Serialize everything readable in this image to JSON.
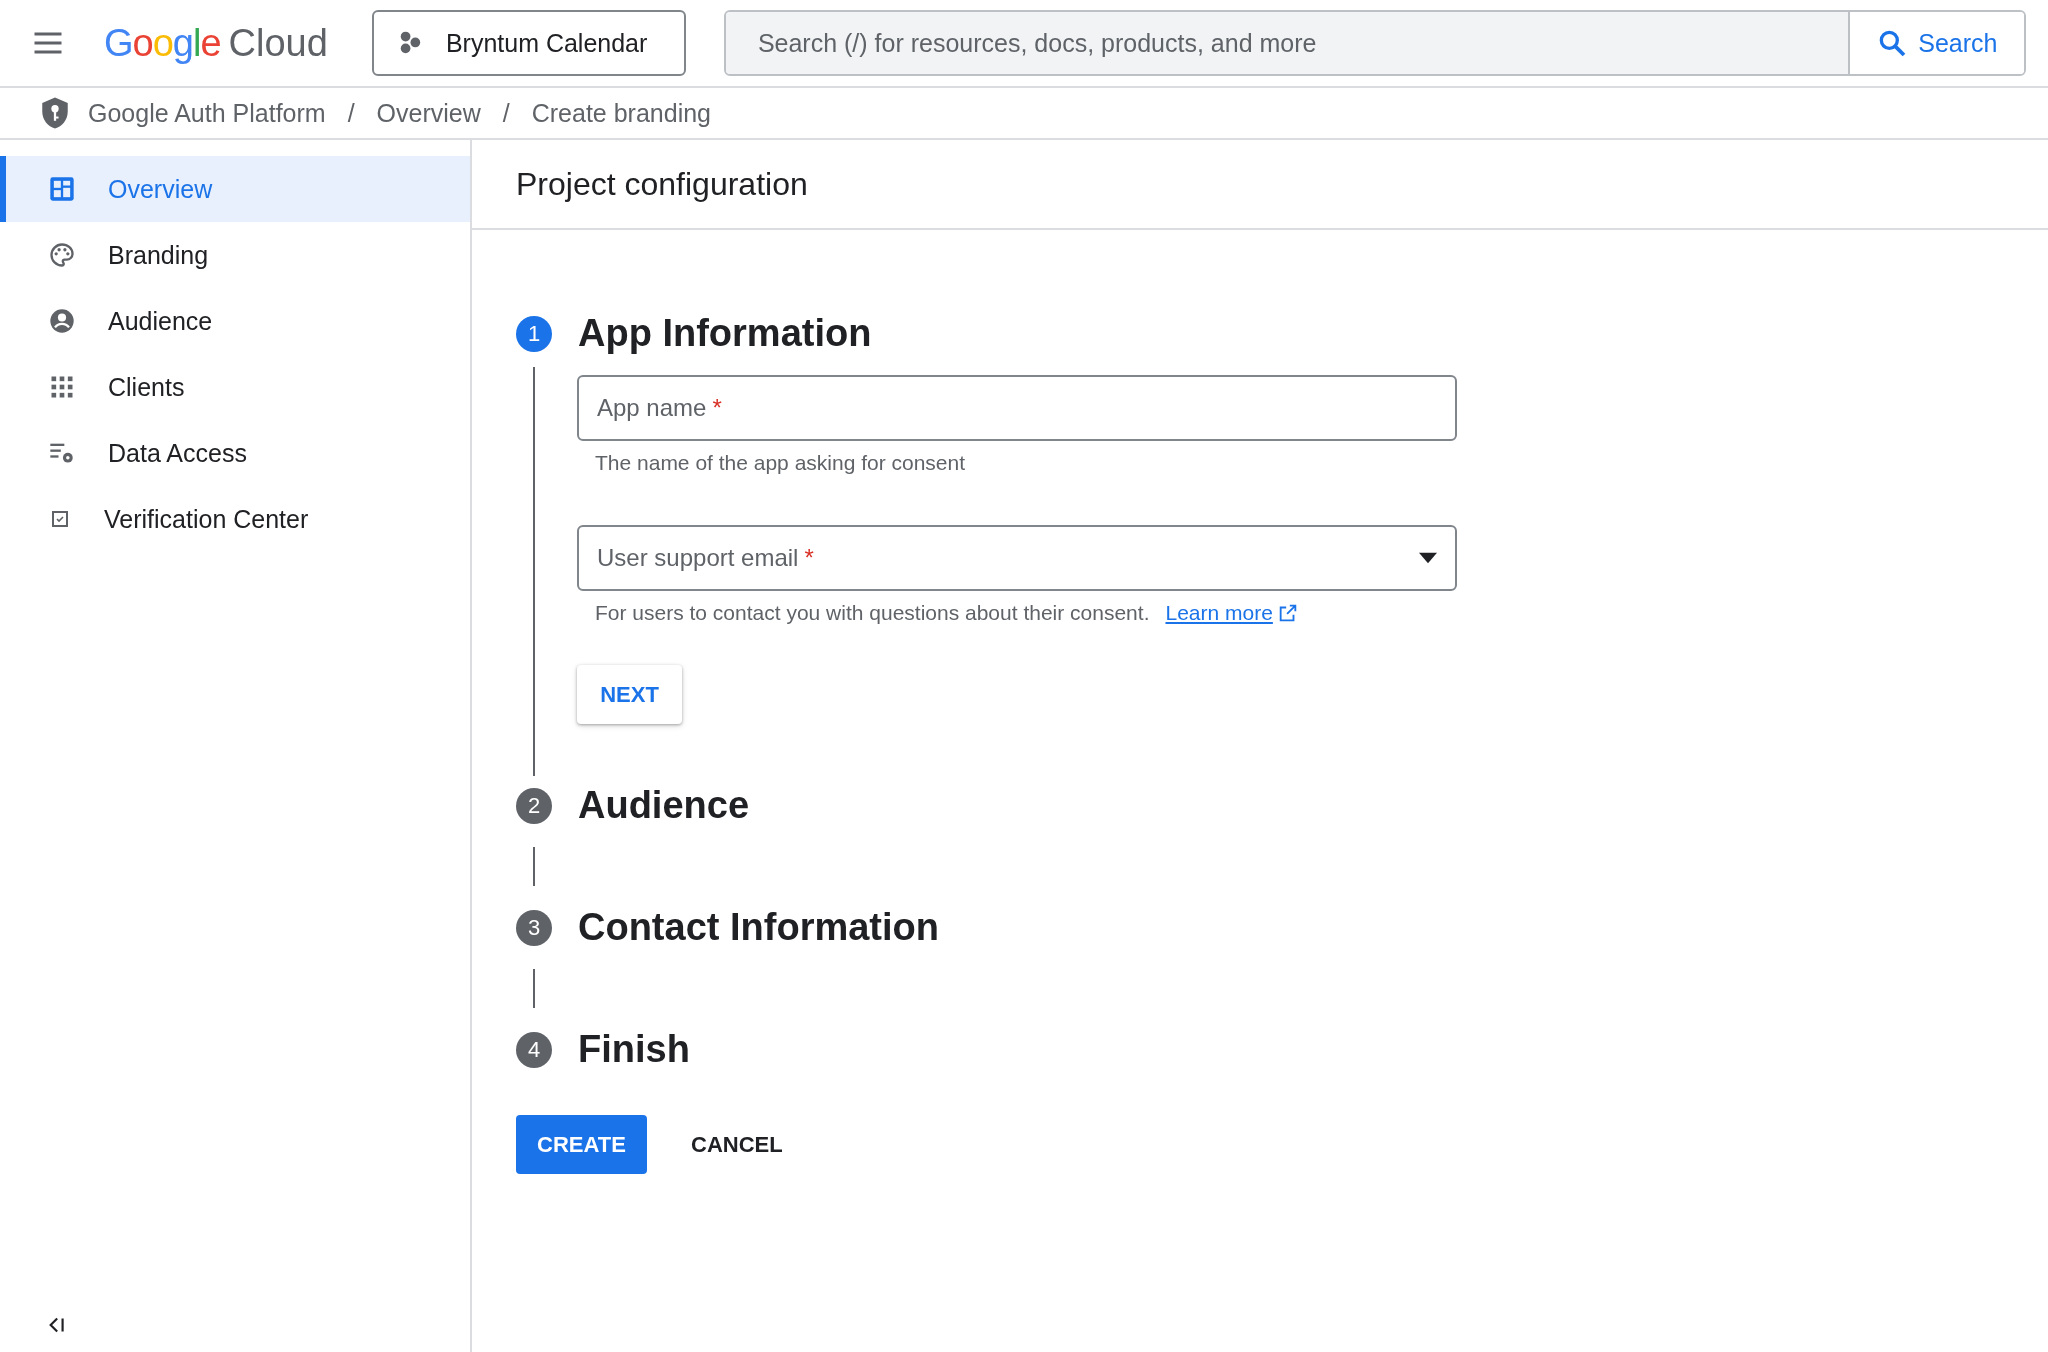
{
  "top_bar": {
    "logo": {
      "brand": "Google",
      "product": "Cloud"
    },
    "project": "Bryntum Calendar",
    "search": {
      "placeholder": "Search (/) for resources, docs, products, and more",
      "button": "Search"
    }
  },
  "breadcrumb": {
    "separator": "/",
    "items": [
      "Google Auth Platform",
      "Overview",
      "Create branding"
    ]
  },
  "sidebar": {
    "items": [
      {
        "label": "Overview",
        "selected": true
      },
      {
        "label": "Branding",
        "selected": false
      },
      {
        "label": "Audience",
        "selected": false
      },
      {
        "label": "Clients",
        "selected": false
      },
      {
        "label": "Data Access",
        "selected": false
      },
      {
        "label": "Verification Center",
        "selected": false
      }
    ]
  },
  "page_title": "Project configuration",
  "steps": [
    {
      "number": "1",
      "title": "App Information",
      "active": true,
      "fields": [
        {
          "kind": "input",
          "label": "App name",
          "required_mark": "*",
          "helper": "The name of the app asking for consent"
        },
        {
          "kind": "select",
          "label": "User support email",
          "required_mark": "*",
          "helper": "For users to contact you with questions about their consent.",
          "link": "Learn more"
        }
      ],
      "next_button": "NEXT"
    },
    {
      "number": "2",
      "title": "Audience",
      "active": false
    },
    {
      "number": "3",
      "title": "Contact Information",
      "active": false
    },
    {
      "number": "4",
      "title": "Finish",
      "active": false
    }
  ],
  "actions": {
    "primary": "CREATE",
    "secondary": "CANCEL"
  }
}
